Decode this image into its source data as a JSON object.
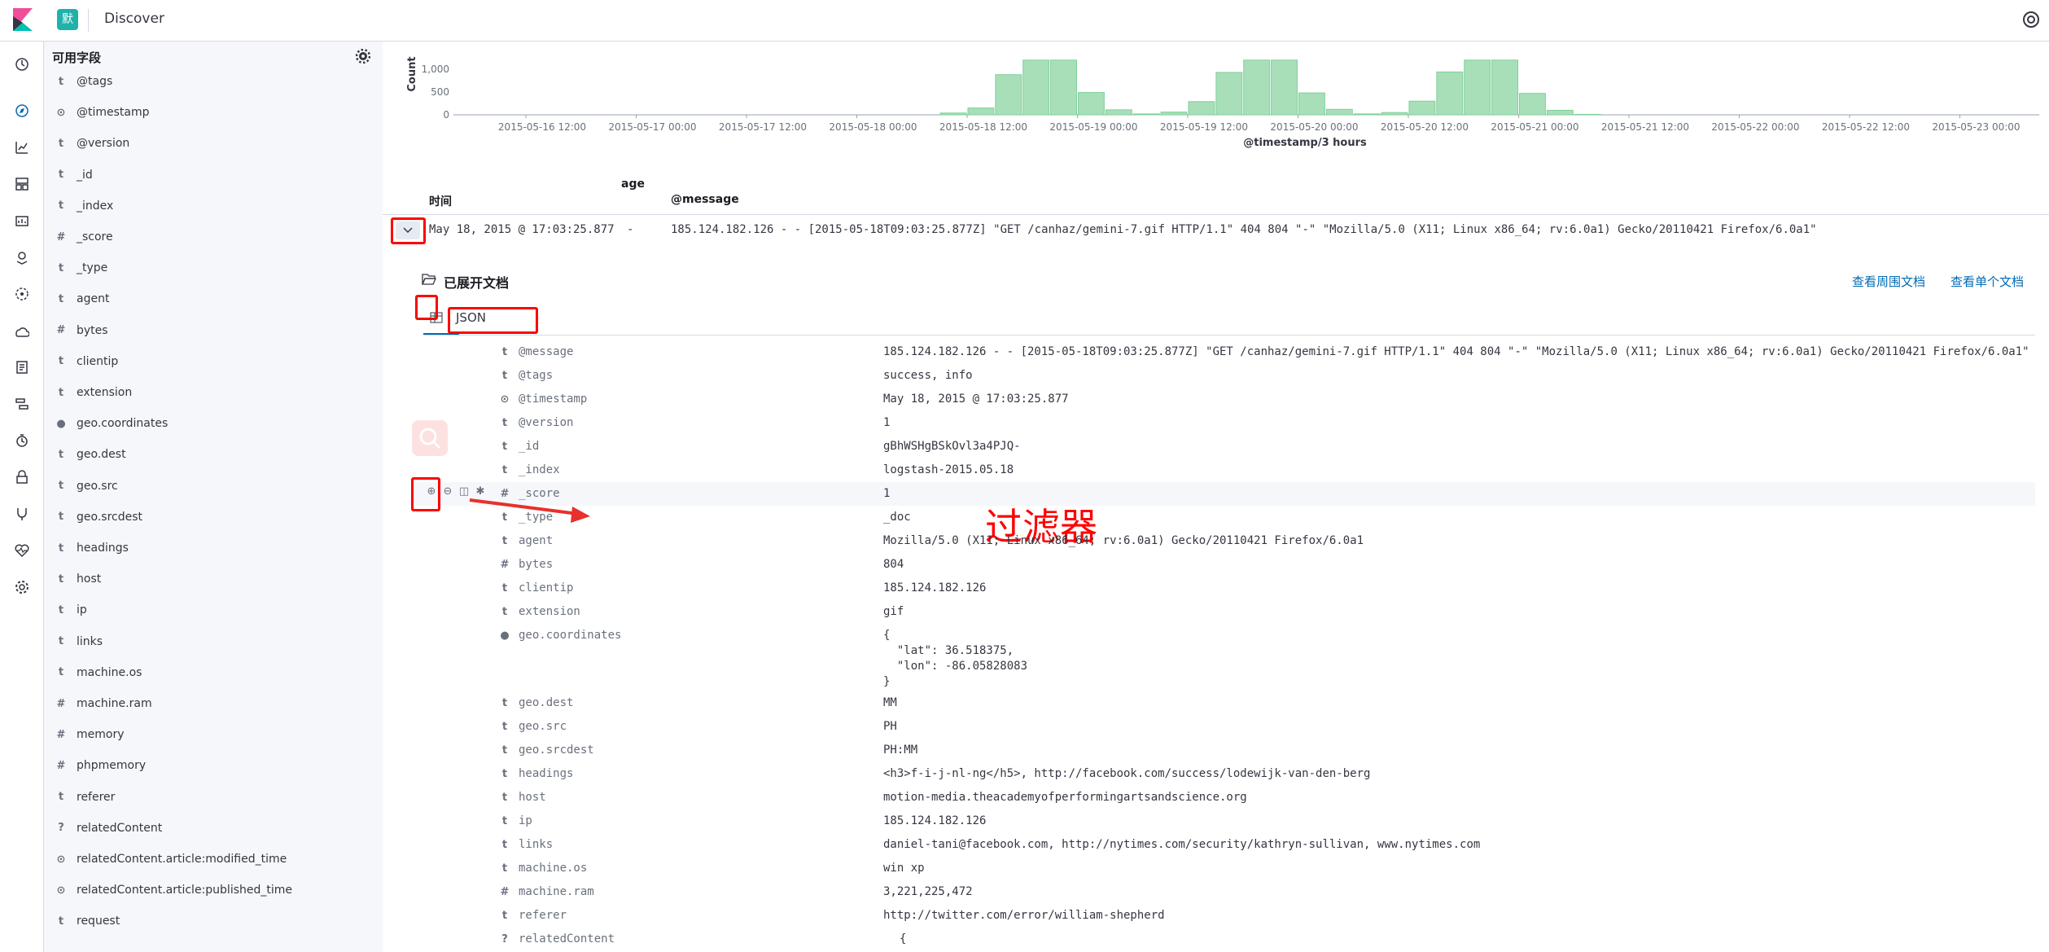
{
  "topbar": {
    "space_badge": "默",
    "title": "Discover"
  },
  "sidebar": {
    "title": "可用字段",
    "fields": [
      {
        "type": "t",
        "name": "@tags"
      },
      {
        "type": "clock",
        "name": "@timestamp"
      },
      {
        "type": "t",
        "name": "@version"
      },
      {
        "type": "t",
        "name": "_id"
      },
      {
        "type": "t",
        "name": "_index"
      },
      {
        "type": "#",
        "name": "_score"
      },
      {
        "type": "t",
        "name": "_type"
      },
      {
        "type": "t",
        "name": "agent"
      },
      {
        "type": "#",
        "name": "bytes"
      },
      {
        "type": "t",
        "name": "clientip"
      },
      {
        "type": "t",
        "name": "extension"
      },
      {
        "type": "globe",
        "name": "geo.coordinates"
      },
      {
        "type": "t",
        "name": "geo.dest"
      },
      {
        "type": "t",
        "name": "geo.src"
      },
      {
        "type": "t",
        "name": "geo.srcdest"
      },
      {
        "type": "t",
        "name": "headings"
      },
      {
        "type": "t",
        "name": "host"
      },
      {
        "type": "t",
        "name": "ip"
      },
      {
        "type": "t",
        "name": "links"
      },
      {
        "type": "t",
        "name": "machine.os"
      },
      {
        "type": "#",
        "name": "machine.ram"
      },
      {
        "type": "#",
        "name": "memory"
      },
      {
        "type": "#",
        "name": "phpmemory"
      },
      {
        "type": "t",
        "name": "referer"
      },
      {
        "type": "?",
        "name": "relatedContent"
      },
      {
        "type": "clock",
        "name": "relatedContent.article:modified_time"
      },
      {
        "type": "clock",
        "name": "relatedContent.article:published_time"
      },
      {
        "type": "t",
        "name": "request"
      }
    ]
  },
  "chart_data": {
    "type": "bar",
    "xlabel": "@timestamp/3 hours",
    "ylabel": "Count",
    "y_ticks": [
      "0",
      "500",
      "1,000"
    ],
    "ylim": [
      0,
      1200
    ],
    "x_ticks": [
      "2015-05-16 12:00",
      "2015-05-17 00:00",
      "2015-05-17 12:00",
      "2015-05-18 00:00",
      "2015-05-18 12:00",
      "2015-05-19 00:00",
      "2015-05-19 12:00",
      "2015-05-20 00:00",
      "2015-05-20 12:00",
      "2015-05-21 00:00",
      "2015-05-21 12:00",
      "2015-05-22 00:00",
      "2015-05-22 12:00",
      "2015-05-23 00:00"
    ],
    "x_start": "2015-05-16 12:00",
    "bin_hours": 3,
    "bars": [
      {
        "x": "2015-05-18 09:00",
        "value": 40
      },
      {
        "x": "2015-05-18 12:00",
        "value": 150
      },
      {
        "x": "2015-05-18 15:00",
        "value": 880
      },
      {
        "x": "2015-05-18 18:00",
        "value": 1200
      },
      {
        "x": "2015-05-18 21:00",
        "value": 1200
      },
      {
        "x": "2015-05-19 00:00",
        "value": 490
      },
      {
        "x": "2015-05-19 03:00",
        "value": 110
      },
      {
        "x": "2015-05-19 06:00",
        "value": 20
      },
      {
        "x": "2015-05-19 09:00",
        "value": 60
      },
      {
        "x": "2015-05-19 12:00",
        "value": 290
      },
      {
        "x": "2015-05-19 15:00",
        "value": 930
      },
      {
        "x": "2015-05-19 18:00",
        "value": 1200
      },
      {
        "x": "2015-05-19 21:00",
        "value": 1200
      },
      {
        "x": "2015-05-20 00:00",
        "value": 480
      },
      {
        "x": "2015-05-20 03:00",
        "value": 120
      },
      {
        "x": "2015-05-20 06:00",
        "value": 20
      },
      {
        "x": "2015-05-20 09:00",
        "value": 50
      },
      {
        "x": "2015-05-20 12:00",
        "value": 300
      },
      {
        "x": "2015-05-20 15:00",
        "value": 940
      },
      {
        "x": "2015-05-20 18:00",
        "value": 1200
      },
      {
        "x": "2015-05-20 21:00",
        "value": 1200
      },
      {
        "x": "2015-05-21 00:00",
        "value": 470
      },
      {
        "x": "2015-05-21 03:00",
        "value": 100
      },
      {
        "x": "2015-05-21 06:00",
        "value": 10
      }
    ],
    "color": "#a8dfb8"
  },
  "table": {
    "col_time": "时间",
    "col_age": "age",
    "col_message": "@message",
    "row": {
      "time": "May 18, 2015 @ 17:03:25.877",
      "age": "-",
      "message": "185.124.182.126 - - [2015-05-18T09:03:25.877Z] \"GET /canhaz/gemini-7.gif HTTP/1.1\" 404 804 \"-\" \"Mozilla/5.0 (X11; Linux x86_64; rv:6.0a1) Gecko/20110421 Firefox/6.0a1\""
    }
  },
  "expanded": {
    "title": "已展开文档",
    "link_surrounding": "查看周围文档",
    "link_single": "查看单个文档",
    "tab_json": "JSON",
    "annotation": "过滤器",
    "rows": [
      {
        "type": "t",
        "name": "@message",
        "value": "185.124.182.126 - - [2015-05-18T09:03:25.877Z] \"GET /canhaz/gemini-7.gif HTTP/1.1\" 404 804 \"-\" \"Mozilla/5.0 (X11; Linux x86_64; rv:6.0a1) Gecko/20110421 Firefox/6.0a1\""
      },
      {
        "type": "t",
        "name": "@tags",
        "value": "success, info"
      },
      {
        "type": "clock",
        "name": "@timestamp",
        "value": "May 18, 2015 @ 17:03:25.877"
      },
      {
        "type": "t",
        "name": "@version",
        "value": "1"
      },
      {
        "type": "t",
        "name": "_id",
        "value": "gBhWSHgBSkOvl3a4PJQ-"
      },
      {
        "type": "t",
        "name": "_index",
        "value": "logstash-2015.05.18"
      },
      {
        "type": "#",
        "name": "_score",
        "value": "1"
      },
      {
        "type": "t",
        "name": "_type",
        "value": "_doc"
      },
      {
        "type": "t",
        "name": "agent",
        "value": "Mozilla/5.0 (X11; Linux x86_64; rv:6.0a1) Gecko/20110421 Firefox/6.0a1"
      },
      {
        "type": "#",
        "name": "bytes",
        "value": "804"
      },
      {
        "type": "t",
        "name": "clientip",
        "value": "185.124.182.126"
      },
      {
        "type": "t",
        "name": "extension",
        "value": "gif"
      },
      {
        "type": "globe",
        "name": "geo.coordinates",
        "value": [
          "{",
          "  \"lat\": 36.518375,",
          "  \"lon\": -86.05828083",
          "}"
        ]
      },
      {
        "type": "t",
        "name": "geo.dest",
        "value": "MM"
      },
      {
        "type": "t",
        "name": "geo.src",
        "value": "PH"
      },
      {
        "type": "t",
        "name": "geo.srcdest",
        "value": "PH:MM"
      },
      {
        "type": "t",
        "name": "headings",
        "value": "<h3>f-i-j-nl-ng</h5>, http://facebook.com/success/lodewijk-van-den-berg"
      },
      {
        "type": "t",
        "name": "host",
        "value": "motion-media.theacademyofperformingartsandscience.org"
      },
      {
        "type": "t",
        "name": "ip",
        "value": "185.124.182.126"
      },
      {
        "type": "t",
        "name": "links",
        "value": "daniel-tani@facebook.com, http://nytimes.com/security/kathryn-sullivan, www.nytimes.com"
      },
      {
        "type": "t",
        "name": "machine.os",
        "value": "win xp"
      },
      {
        "type": "#",
        "name": "machine.ram",
        "value": "3,221,225,472"
      },
      {
        "type": "t",
        "name": "referer",
        "value": "http://twitter.com/error/william-shepherd"
      },
      {
        "type": "?",
        "name": "relatedContent",
        "value": "{"
      }
    ]
  }
}
